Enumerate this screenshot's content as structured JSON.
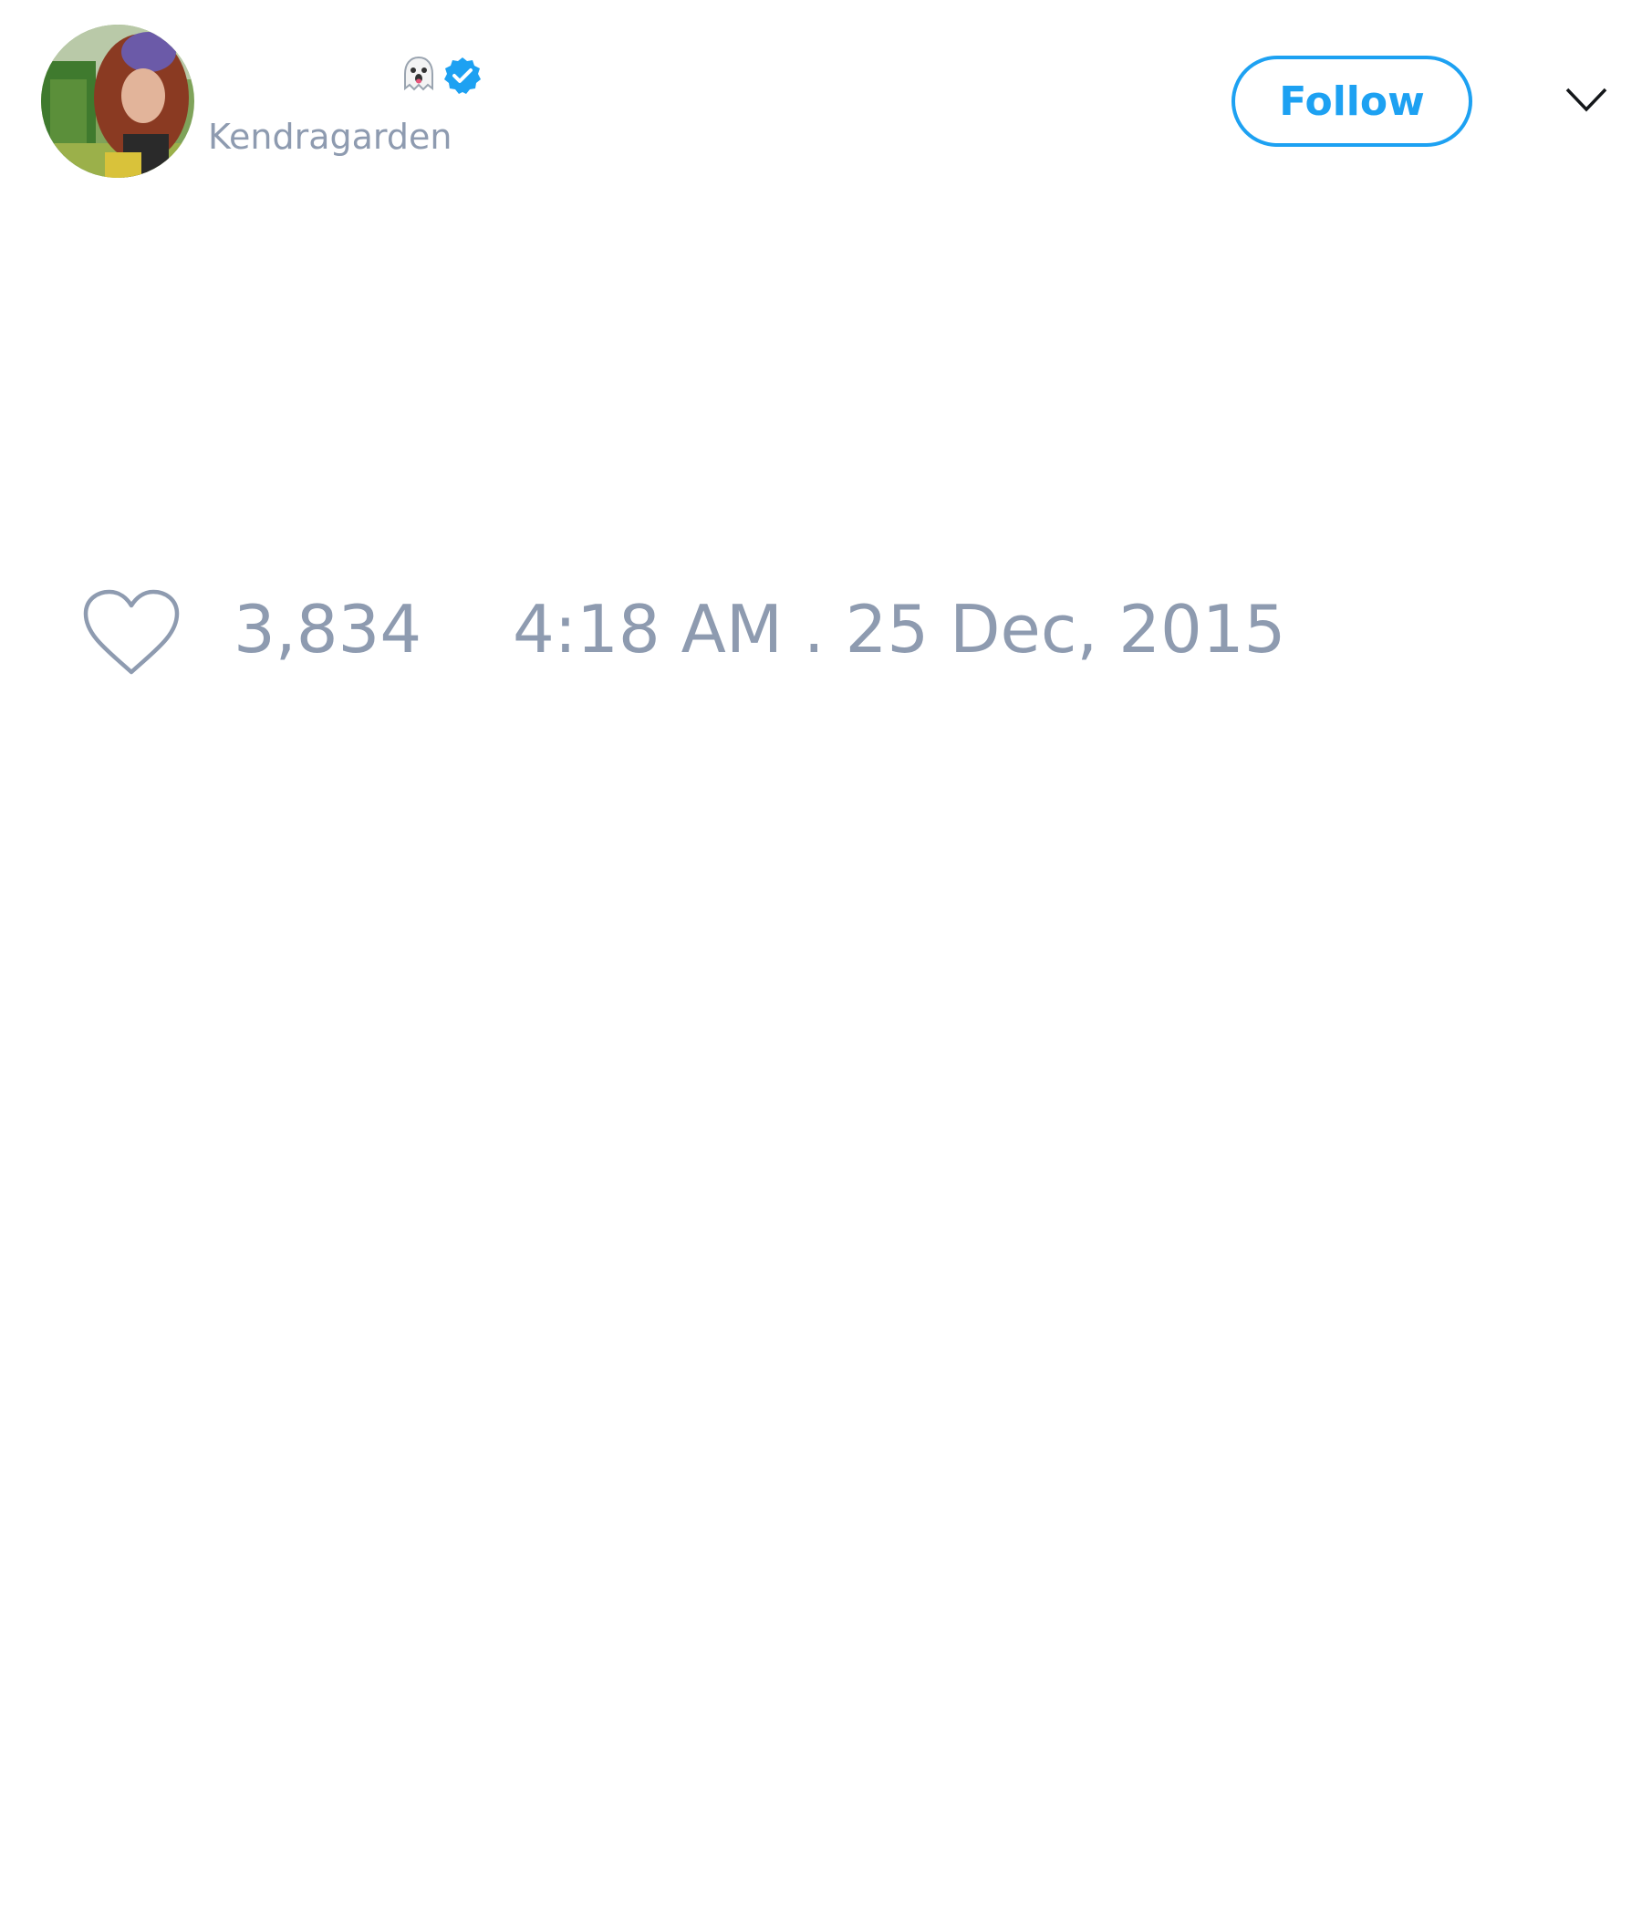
{
  "tweet": {
    "author": {
      "display_name": "",
      "handle": "Kendragarden",
      "verified": true,
      "emoji": "👻"
    },
    "follow_label": "Follow",
    "like_count": "3,834",
    "timestamp": "4:18 AM . 25 Dec, 2015"
  },
  "icons": {
    "avatar": "profile-photo",
    "verified": "verified-badge-icon",
    "menu": "chevron-down-icon",
    "like": "heart-outline-icon"
  },
  "colors": {
    "accent": "#1da1f2",
    "muted_text": "#8e9bb0",
    "primary_text": "#14171a",
    "background": "#ffffff"
  }
}
